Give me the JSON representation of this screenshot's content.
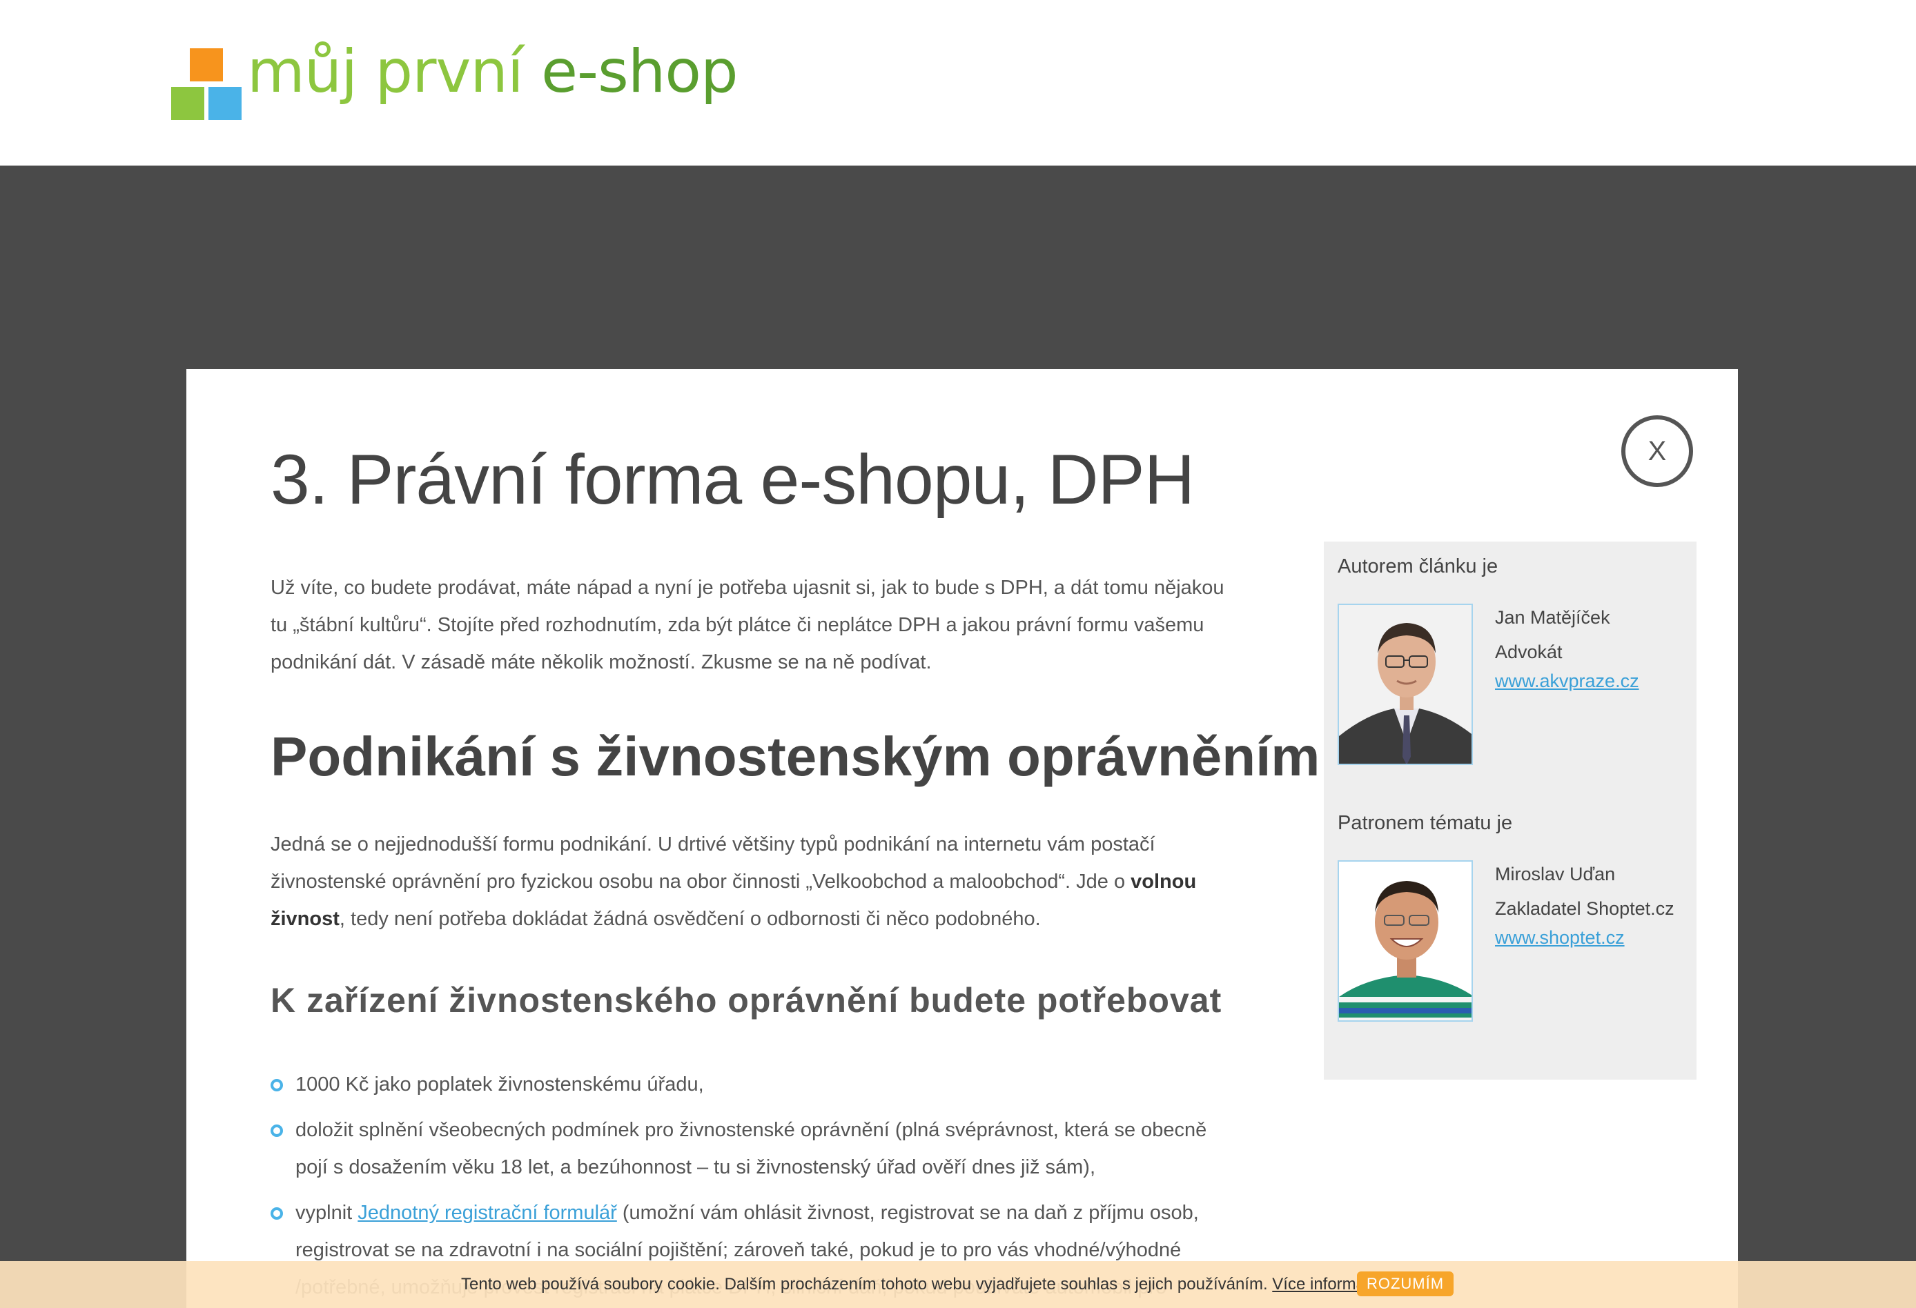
{
  "header": {
    "logo_text_1": "můj první",
    "logo_text_2": " e-shop"
  },
  "modal": {
    "close_label": "X",
    "title": "3. Právní forma e-shopu, DPH",
    "intro": "Už víte, co budete prodávat, máte nápad a nyní je potřeba ujasnit si, jak to bude s DPH, a dát tomu nějakou tu „štábní kultůru“. Stojíte před rozhodnutím, zda být plátce či neplátce DPH a jakou právní formu vašemu podnikání dát. V zásadě máte několik možností. Zkusme se na ně podívat.",
    "section_heading": "Podnikání s živnostenským oprávněním",
    "section_text_1": "Jedná se o nejjednodušší formu podnikání. U drtivé většiny typů podnikání na internetu vám postačí živnostenské oprávnění pro fyzickou osobu na obor činnosti „Velkoobchod a maloobchod“. Jde o ",
    "section_text_bold": "volnou živnost",
    "section_text_2": ", tedy není potřeba dokládat žádná osvědčení o odbornosti či něco podobného.",
    "subheading": "K zařízení živnostenského oprávnění budete potřebovat",
    "list": {
      "item1": "1000 Kč jako poplatek živnostenskému úřadu,",
      "item2": "doložit splnění všeobecných podmínek pro živnostenské oprávnění (plná svéprávnost, která se obecně pojí s dosažením věku 18 let, a bezúhonnost – tu si živnostenský úřad ověří dnes již sám),",
      "item3_pre": "vyplnit ",
      "item3_link": "Jednotný registrační formulář",
      "item3_post": " (umožní vám ohlásit živnost, registrovat se na daň z příjmu osob, registrovat se na zdravotní i na sociální pojištění; zároveň také, pokud je to pro vás vhodné/výhodné /potřebné, umožňuje provést registraci na plátce DPH, silniční daň, pokud používáte automobil pro"
    }
  },
  "sidebar": {
    "author_heading": "Autorem článku je",
    "author": {
      "name": "Jan Matějíček",
      "role": "Advokát",
      "link": "www.akvpraze.cz"
    },
    "patron_heading": "Patronem tématu je",
    "patron": {
      "name": "Miroslav Uďan",
      "role": "Zakladatel Shoptet.cz",
      "link": "www.shoptet.cz"
    }
  },
  "cookie": {
    "text": "Tento web používá soubory cookie. Dalším procházením tohoto webu vyjadřujete souhlas s jejich používáním. ",
    "link": "Více informací zde",
    "button": "ROZUMÍM"
  }
}
